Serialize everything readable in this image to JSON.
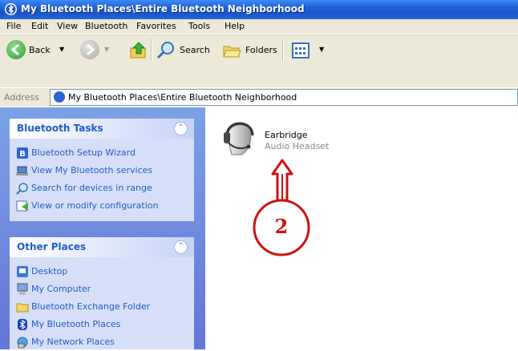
{
  "window": {
    "title": "My Bluetooth Places\\Entire Bluetooth Neighborhood"
  },
  "menu": [
    "File",
    "Edit",
    "View",
    "Bluetooth",
    "Favorites",
    "Tools",
    "Help"
  ],
  "toolbar": {
    "back_label": "Back",
    "search_label": "Search",
    "folders_label": "Folders"
  },
  "address": {
    "label": "Address",
    "value": "My Bluetooth Places\\Entire Bluetooth Neighborhood"
  },
  "sidebar": {
    "tasks": {
      "title": "Bluetooth Tasks",
      "items": [
        {
          "label": "Bluetooth Setup Wizard",
          "icon": "bluetooth-wizard-icon"
        },
        {
          "label": "View My Bluetooth services",
          "icon": "laptop-services-icon"
        },
        {
          "label": "Search for devices in range",
          "icon": "magnifier-icon"
        },
        {
          "label": "View or modify configuration",
          "icon": "configuration-icon"
        }
      ]
    },
    "other": {
      "title": "Other Places",
      "items": [
        {
          "label": "Desktop",
          "icon": "desktop-icon"
        },
        {
          "label": "My Computer",
          "icon": "computer-icon"
        },
        {
          "label": "Bluetooth Exchange Folder",
          "icon": "folder-icon"
        },
        {
          "label": "My Bluetooth Places",
          "icon": "bluetooth-icon"
        },
        {
          "label": "My Network Places",
          "icon": "network-places-icon"
        }
      ]
    }
  },
  "device": {
    "name": "Earbridge",
    "type": "Audio Headset",
    "icon": "headset-icon"
  },
  "annotation": {
    "number": "2",
    "color": "#cc1111"
  },
  "colors": {
    "titlebar": "#1f5fd6",
    "sidebar": "#6f8fe0",
    "link": "#215dc6"
  }
}
